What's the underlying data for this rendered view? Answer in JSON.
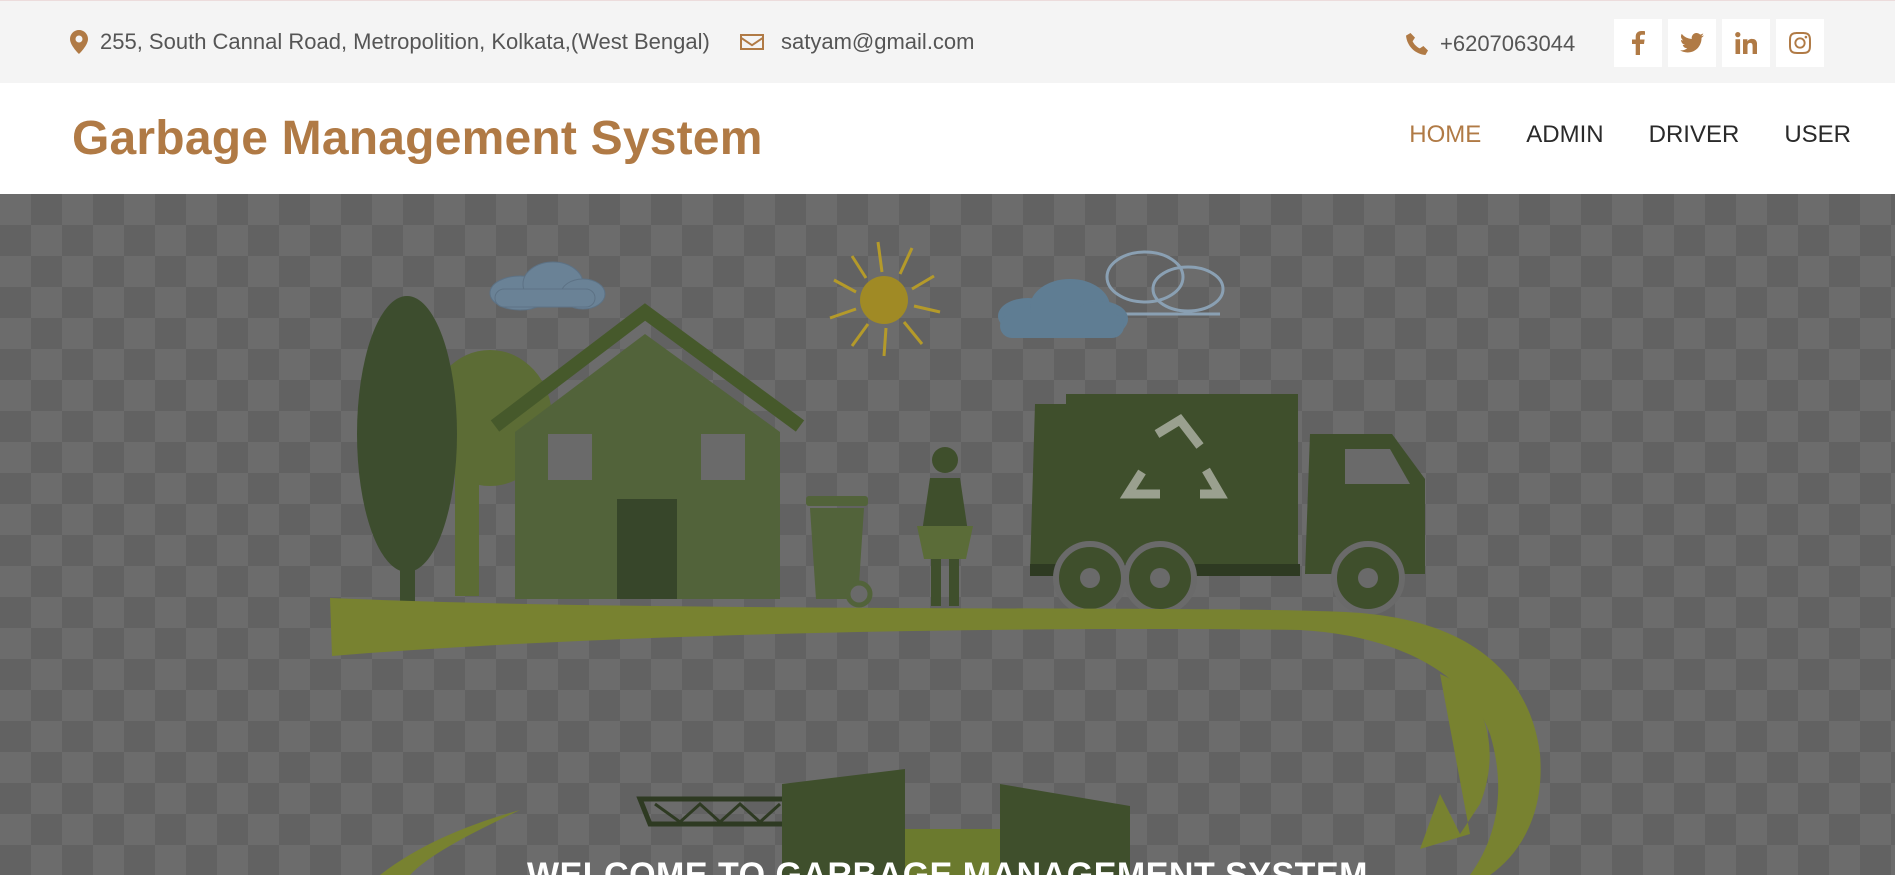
{
  "topbar": {
    "address": "255, South Cannal Road, Metropolition, Kolkata,(West Bengal)",
    "email": "satyam@gmail.com",
    "phone": "+6207063044",
    "social_icons": [
      "facebook-icon",
      "twitter-icon",
      "linkedin-icon",
      "instagram-icon"
    ]
  },
  "header": {
    "brand": "Garbage Management System"
  },
  "nav": {
    "items": [
      {
        "label": "HOME",
        "active": true
      },
      {
        "label": "ADMIN",
        "active": false
      },
      {
        "label": "DRIVER",
        "active": false
      },
      {
        "label": "USER",
        "active": false
      }
    ]
  },
  "hero": {
    "title": "WELCOME TO GARBAGE MANAGEMENT SYSTEM"
  },
  "colors": {
    "accent": "#b07a45",
    "topbar_bg": "#f4f4f4",
    "nav_text": "#2a2a2a",
    "hero_overlay": "#6c6c6c"
  }
}
